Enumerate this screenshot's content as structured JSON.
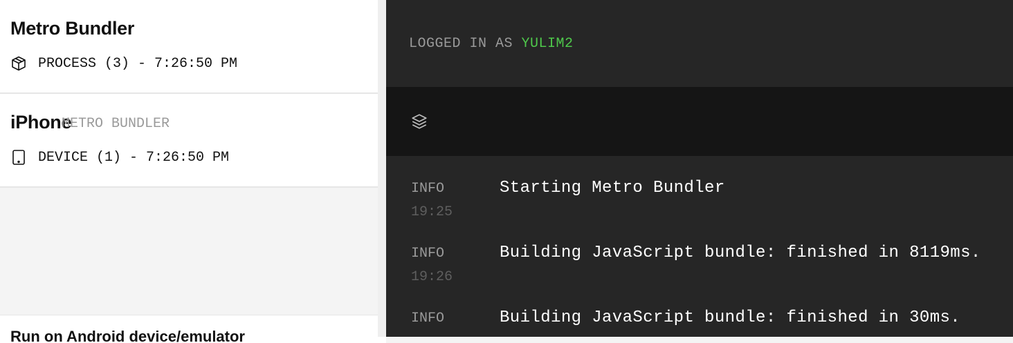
{
  "sidebar": {
    "cards": [
      {
        "title": "Metro Bundler",
        "icon": "cube-icon",
        "meta": "PROCESS (3) - 7:26:50 PM"
      },
      {
        "title": "iPhone",
        "icon": "phone-icon",
        "meta": "DEVICE (1) - 7:26:50 PM"
      }
    ],
    "run_android_label": "Run on Android device/emulator"
  },
  "header": {
    "logged_in_label": "LOGGED IN AS ",
    "username": "YULIM2"
  },
  "section": {
    "icon": "layers-icon",
    "title": "METRO BUNDLER"
  },
  "log": [
    {
      "level": "INFO",
      "time": "19:25",
      "message": "Starting Metro Bundler"
    },
    {
      "level": "INFO",
      "time": "19:26",
      "message": "Building JavaScript bundle: finished in 8119ms."
    },
    {
      "level": "INFO",
      "time": "",
      "message": "Building JavaScript bundle: finished in 30ms."
    }
  ],
  "colors": {
    "accent_green": "#4fc94b",
    "dark_bg": "#262626",
    "header_bg": "#151515"
  }
}
